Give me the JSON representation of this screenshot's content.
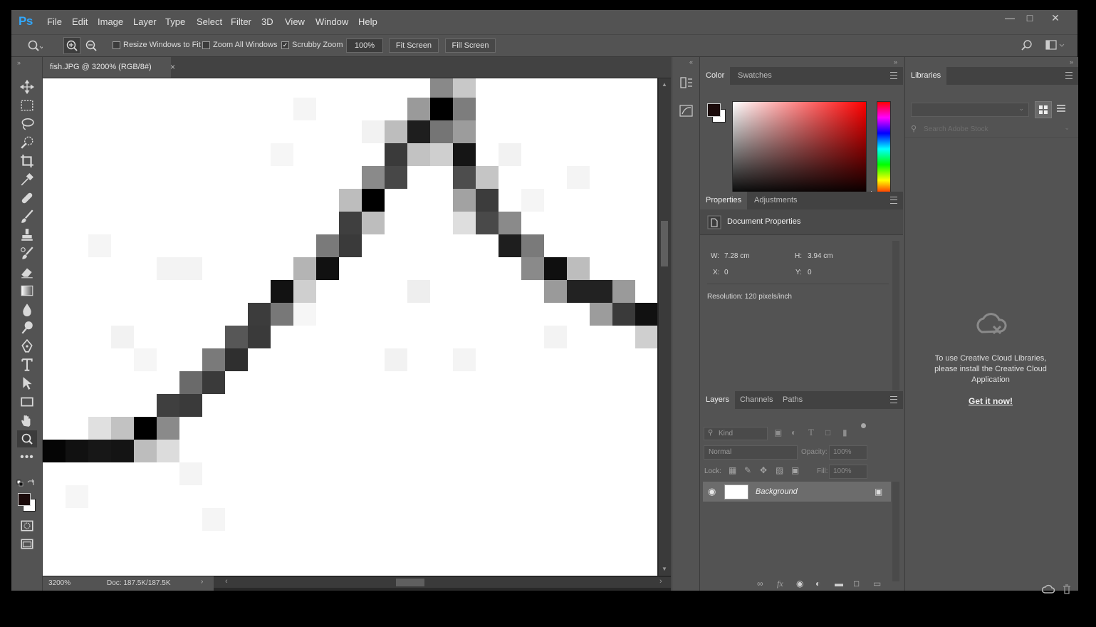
{
  "app": {
    "logo": "Ps",
    "window_controls": [
      "minimize-icon",
      "maximize-icon",
      "close-icon"
    ]
  },
  "menu": [
    "File",
    "Edit",
    "Image",
    "Layer",
    "Type",
    "Select",
    "Filter",
    "3D",
    "View",
    "Window",
    "Help"
  ],
  "options": {
    "resize_windows": "Resize Windows to Fit",
    "zoom_all": "Zoom All Windows",
    "scrubby_zoom": "Scrubby Zoom",
    "zoom_value": "100%",
    "fit_screen": "Fit Screen",
    "fill_screen": "Fill Screen",
    "scrubby_checked": true
  },
  "document": {
    "tab_title": "fish.JPG @ 3200% (RGB/8#)",
    "zoom": "3200%",
    "doc_info": "Doc: 187.5K/187.5K"
  },
  "color_panel": {
    "tabs": [
      "Color",
      "Swatches"
    ],
    "foreground": "#1a0a0a",
    "background": "#ffffff",
    "hue": "#ff0000"
  },
  "properties": {
    "tabs": [
      "Properties",
      "Adjustments"
    ],
    "title": "Document Properties",
    "w_label": "W:",
    "w_value": "7.28 cm",
    "h_label": "H:",
    "h_value": "3.94 cm",
    "x_label": "X:",
    "x_value": "0",
    "y_label": "Y:",
    "y_value": "0",
    "resolution": "Resolution: 120 pixels/inch"
  },
  "layers": {
    "tabs": [
      "Layers",
      "Channels",
      "Paths"
    ],
    "kind": "Kind",
    "blend": "Normal",
    "opacity_label": "Opacity:",
    "opacity_value": "100%",
    "lock_label": "Lock:",
    "fill_label": "Fill:",
    "fill_value": "100%",
    "layer_name": "Background"
  },
  "libraries": {
    "title": "Libraries",
    "search_placeholder": "Search Adobe Stock",
    "message": "To use Creative Cloud Libraries, please install the Creative Cloud Application",
    "link": "Get it now!"
  }
}
